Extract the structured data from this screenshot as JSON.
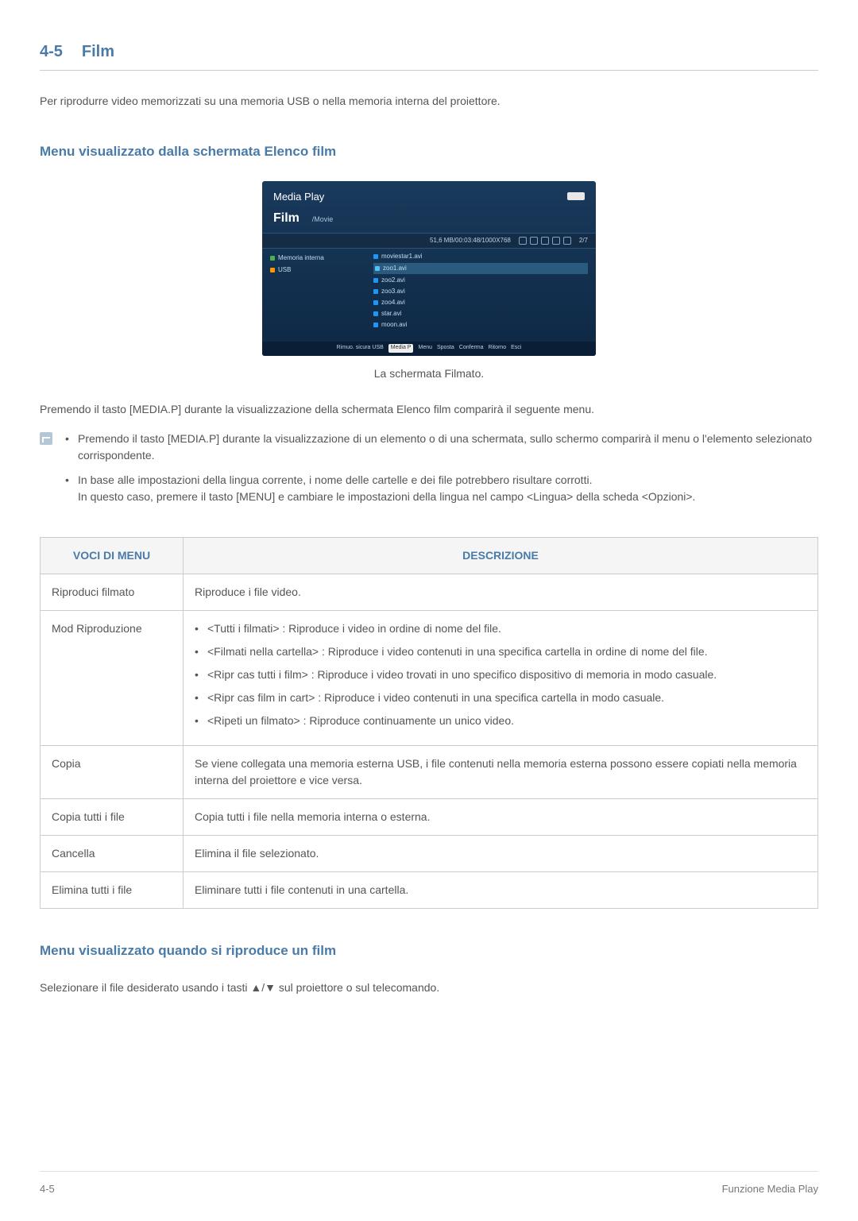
{
  "section": {
    "num": "4-5",
    "title": "Film"
  },
  "intro": "Per riprodurre video memorizzati su una memoria USB o nella memoria interna del proiettore.",
  "subheading1": "Menu visualizzato dalla schermata Elenco film",
  "screenshot": {
    "header_title": "Media Play",
    "tab": "Film",
    "tab_sub": "/Movie",
    "info_bar": "51,6 MB/00:03:48/1000X768",
    "page_indicator": "2/7",
    "left_items": [
      {
        "dot": "green",
        "label": "Memoria interna"
      },
      {
        "dot": "orange",
        "label": "USB"
      }
    ],
    "files": [
      {
        "name": "moviestar1.avi",
        "selected": false
      },
      {
        "name": "zoo1.avi",
        "selected": true
      },
      {
        "name": "zoo2.avi",
        "selected": false
      },
      {
        "name": "zoo3.avi",
        "selected": false
      },
      {
        "name": "zoo4.avi",
        "selected": false
      },
      {
        "name": "star.avi",
        "selected": false
      },
      {
        "name": "moon.avi",
        "selected": false
      }
    ],
    "footer_items": [
      "Rimuo. sicura USB",
      "Media P",
      "Menu",
      "Sposta",
      "Conferma",
      "Ritorno",
      "Esci"
    ]
  },
  "caption": "La schermata Filmato.",
  "paragraph1": "Premendo il tasto [MEDIA.P] durante la visualizzazione della schermata Elenco film comparirà il seguente menu.",
  "info_bullets": {
    "b1": "Premendo il tasto [MEDIA.P] durante la visualizzazione di un elemento o di una schermata, sullo schermo comparirà il menu o l'elemento selezionato corrispondente.",
    "b2a": "In base alle impostazioni della lingua corrente, i nome delle cartelle e dei file potrebbero risultare corrotti.",
    "b2b": "In questo caso, premere il tasto [MENU] e cambiare le impostazioni della lingua nel campo <Lingua> della scheda <Opzioni>."
  },
  "table": {
    "header_menu": "VOCI DI MENU",
    "header_desc": "DESCRIZIONE",
    "rows": [
      {
        "menu": "Riproduci filmato",
        "desc_plain": "Riproduce i file video."
      },
      {
        "menu": "Mod Riproduzione",
        "options": [
          "<Tutti i filmati> : Riproduce i video in ordine di nome del file.",
          "<Filmati nella cartella> : Riproduce i video contenuti in una specifica cartella in ordine di nome del file.",
          "<Ripr cas tutti i film> : Riproduce i video trovati in uno specifico dispositivo di memoria in modo casuale.",
          "<Ripr cas film in cart> : Riproduce i video contenuti in una specifica cartella in modo casuale.",
          "<Ripeti un filmato> : Riproduce continuamente un unico video."
        ]
      },
      {
        "menu": "Copia",
        "desc_plain": "Se viene collegata una memoria esterna USB, i file contenuti nella memoria esterna possono essere copiati nella memoria interna del proiettore e vice versa."
      },
      {
        "menu": "Copia tutti i file",
        "desc_plain": "Copia tutti i file nella memoria interna o esterna."
      },
      {
        "menu": "Cancella",
        "desc_plain": "Elimina il file selezionato."
      },
      {
        "menu": "Elimina tutti i file",
        "desc_plain": "Eliminare tutti i file contenuti in una cartella."
      }
    ]
  },
  "subheading2": "Menu visualizzato quando si riproduce un film",
  "paragraph2": "Selezionare il file desiderato usando i tasti ▲/▼ sul proiettore o sul telecomando.",
  "footer": {
    "left": "4-5",
    "right": "Funzione Media Play"
  }
}
